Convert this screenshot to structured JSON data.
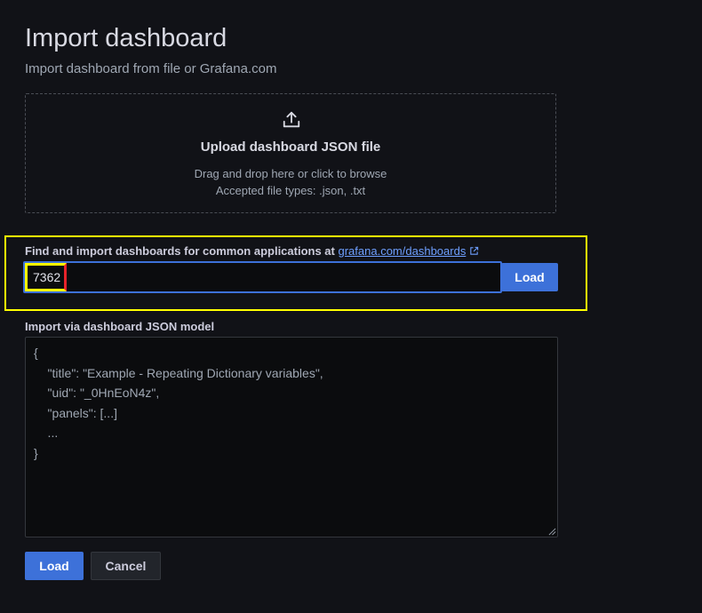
{
  "header": {
    "title": "Import dashboard",
    "subtitle": "Import dashboard from file or Grafana.com"
  },
  "upload": {
    "icon": "upload-icon",
    "title": "Upload dashboard JSON file",
    "hint_line1": "Drag and drop here or click to browse",
    "hint_line2": "Accepted file types: .json, .txt"
  },
  "grafana_com": {
    "label": "Find and import dashboards for common applications at",
    "link_text": "grafana.com/dashboards",
    "link_icon": "external-link-icon",
    "input_value": "7362",
    "load_label": "Load"
  },
  "json_model": {
    "label": "Import via dashboard JSON model",
    "placeholder_lines": [
      "{",
      "    \"title\": \"Example - Repeating Dictionary variables\",",
      "    \"uid\": \"_0HnEoN4z\",",
      "    \"panels\": [...]",
      "    ...",
      "}"
    ]
  },
  "footer": {
    "load_label": "Load",
    "cancel_label": "Cancel"
  },
  "colors": {
    "background": "#111217",
    "primary": "#3d71d9",
    "link": "#6e9fff",
    "annotation_highlight": "#ffff00"
  }
}
